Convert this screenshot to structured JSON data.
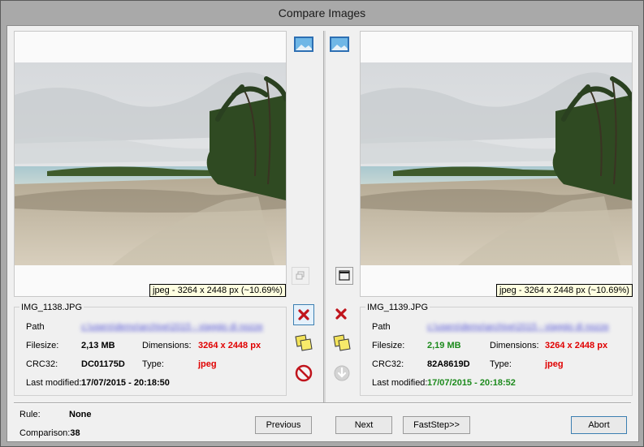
{
  "window": {
    "title": "Compare Images"
  },
  "left": {
    "image_info": "jpeg - 3264 x 2448 px (~10.69%)",
    "filename": "IMG_1138.JPG",
    "path_label": "Path",
    "path_value": "c:\\users\\demo\\archive\\2015 - viaggio di nozze",
    "filesize_label": "Filesize:",
    "filesize_value": "2,13 MB",
    "dimensions_label": "Dimensions:",
    "dimensions_value": "3264 x 2448 px",
    "crc_label": "CRC32:",
    "crc_value": "DC01175D",
    "type_label": "Type:",
    "type_value": "jpeg",
    "modified_label": "Last modified:",
    "modified_value": "17/07/2015 - 20:18:50"
  },
  "right": {
    "image_info": "jpeg - 3264 x 2448 px (~10.69%)",
    "filename": "IMG_1139.JPG",
    "path_label": "Path",
    "path_value": "c:\\users\\demo\\archive\\2015 - viaggio di nozze",
    "filesize_label": "Filesize:",
    "filesize_value": "2,19 MB",
    "dimensions_label": "Dimensions:",
    "dimensions_value": "3264 x 2448 px",
    "crc_label": "CRC32:",
    "crc_value": "82A8619D",
    "type_label": "Type:",
    "type_value": "jpeg",
    "modified_label": "Last modified:",
    "modified_value": "17/07/2015 - 20:18:52"
  },
  "footer": {
    "rule_label": "Rule:",
    "rule_value": "None",
    "comparison_label": "Comparison:",
    "comparison_value": "38"
  },
  "buttons": {
    "previous": "Previous",
    "next": "Next",
    "faststep": "FastStep>>",
    "abort": "Abort"
  },
  "colors": {
    "red": "#e00000",
    "green": "#1c8a1c"
  },
  "icons": [
    "picture-icon",
    "restore-window-icon",
    "maximize-window-icon",
    "delete-x-icon",
    "move-copy-icon",
    "no-entry-icon",
    "down-arrow-icon"
  ]
}
